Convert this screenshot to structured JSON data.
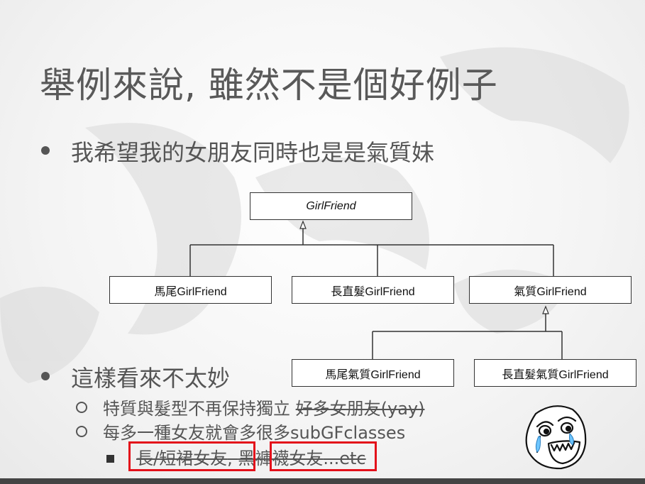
{
  "slide": {
    "title": "舉例來說, 雖然不是個好例子",
    "bullets": [
      {
        "text": "我希望我的女朋友同時也是是氣質妹"
      },
      {
        "text": "這樣看來不太妙",
        "subitems": [
          {
            "text": "特質與髮型不再保持獨立 ",
            "struck": "好多女朋友(yay)"
          },
          {
            "text": "每多一種女友就會多很多subGFclasses"
          }
        ],
        "subsubitem": {
          "part1": "長/短裙女友",
          "sep": ", ",
          "part2": "黑褲襪女友",
          "etc": "...etc"
        }
      }
    ]
  },
  "diagram": {
    "root": "GirlFriend",
    "level1": [
      "馬尾GirlFriend",
      "長直髮GirlFriend",
      "氣質GirlFriend"
    ],
    "level2": [
      "馬尾氣質GirlFriend",
      "長直髮氣質GirlFriend"
    ]
  },
  "colors": {
    "highlight": "#e3101a",
    "text": "#555555"
  },
  "decorations": {
    "meme_face": "happy-crying-meme-face-icon"
  }
}
